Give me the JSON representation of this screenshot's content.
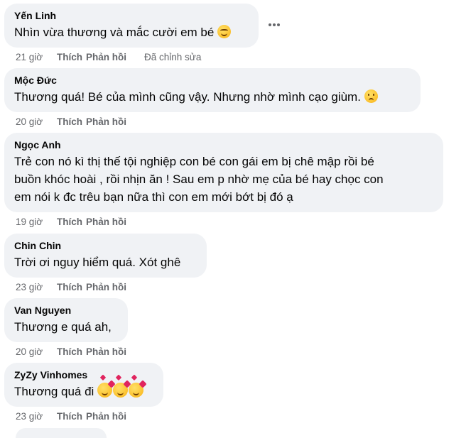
{
  "comments": [
    {
      "author": "Yến Linh",
      "text": "Nhìn vừa thương và mắc cười em bé",
      "emoji": "smiling-face-icon",
      "time": "21 giờ",
      "like": "Thích",
      "reply": "Phản hồi",
      "edited": "Đã chỉnh sửa"
    },
    {
      "author": "Mộc Đức",
      "text": "Thương quá! Bé của mình cũng vậy. Nhưng nhờ mình cạo giùm.",
      "emoji": "sad-face-icon",
      "time": "20 giờ",
      "like": "Thích",
      "reply": "Phản hồi"
    },
    {
      "author": "Ngọc Anh",
      "text": "Trẻ con nó kì thị thế tội nghiệp con bé con gái em bị chê mập rồi bé\nbuồn khóc hoài , rồi nhịn ăn ! Sau em p nhờ mẹ của bé hay chọc con\nem nói k đc trêu bạn nữa thì con em mới bớt bị đó ạ",
      "time": "19 giờ",
      "like": "Thích",
      "reply": "Phản hồi"
    },
    {
      "author": "Chin Chin",
      "text": "Trời ơi nguy hiểm quá. Xót ghê",
      "time": "23 giờ",
      "like": "Thích",
      "reply": "Phản hồi"
    },
    {
      "author": "Van Nguyen",
      "text": "Thương e quá ah,",
      "time": "20 giờ",
      "like": "Thích",
      "reply": "Phản hồi"
    },
    {
      "author": "ZyZy Vinhomes",
      "text": "Thương quá đi",
      "emoji": "smiling-face-with-hearts-icon",
      "time": "23 giờ",
      "like": "Thích",
      "reply": "Phản hồi"
    }
  ],
  "colors": {
    "bubble_bg": "#f0f2f5",
    "meta_text": "#65676b",
    "text": "#050505"
  }
}
